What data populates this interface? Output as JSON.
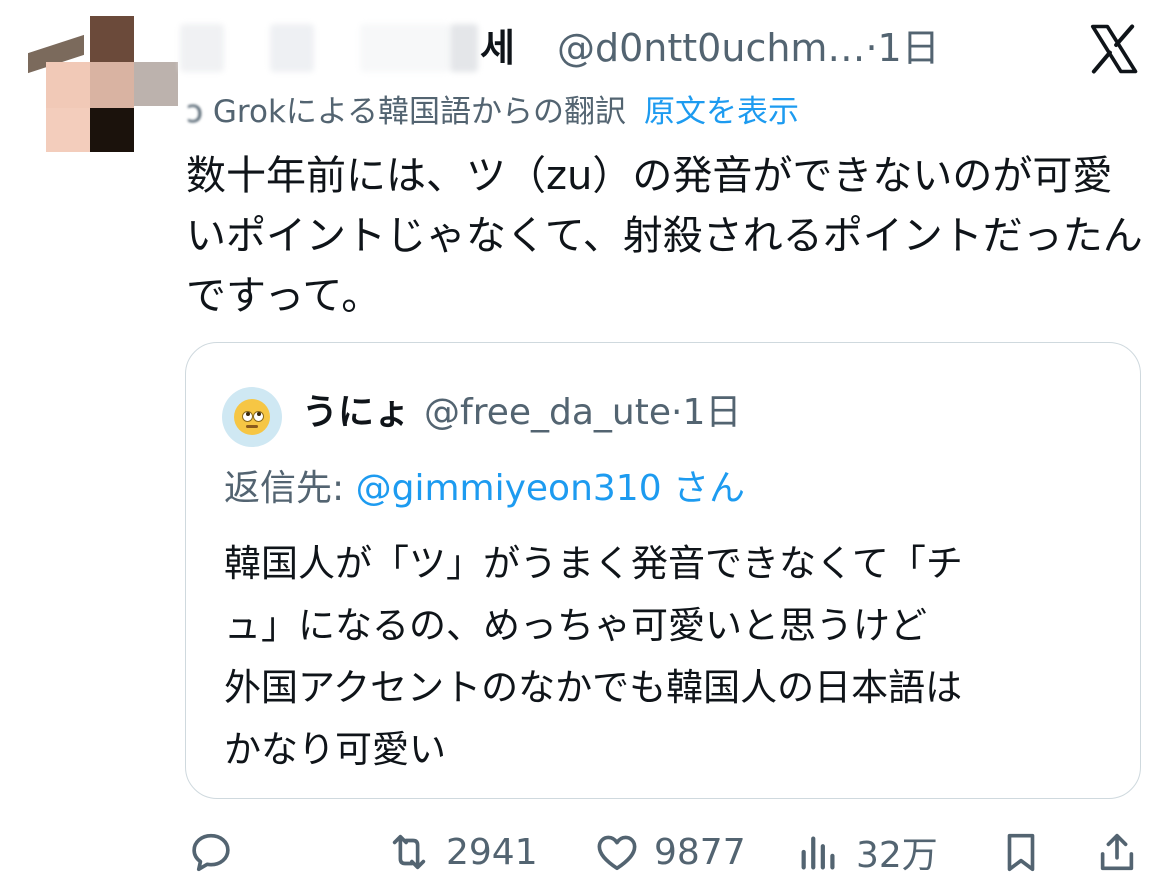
{
  "tweet": {
    "author_name_fragment": "세",
    "author_handle": "@d0ntt0uchm…",
    "separator": "·",
    "time": "1日",
    "translation_label": "Grokによる韓国語からの翻訳",
    "show_original": "原文を表示",
    "text": "数十年前には、ツ（zu）の発音ができないのが可愛いポイントじゃなくて、射殺されるポイントだったんですって。"
  },
  "quote": {
    "author_name": "うにょ",
    "author_handle": "@free_da_ute",
    "separator": "·",
    "time": "1日",
    "reply_prefix": "返信先:",
    "reply_mention": "@gimmiyeon310",
    "reply_suffix": "さん",
    "text_line1": "韓国人が「ツ」がうまく発音できなくて「チ",
    "text_line2": "ュ」になるの、めっちゃ可愛いと思うけど",
    "text_line3": "外国アクセントのなかでも韓国人の日本語は",
    "text_line4": "かなり可愛い"
  },
  "actions": {
    "reply_icon": "reply-icon",
    "retweet_count": "2941",
    "like_count": "9877",
    "views_count": "32万"
  },
  "colors": {
    "accent": "#1d9bf0",
    "secondary_text": "#536471",
    "border": "#cfd9de"
  }
}
